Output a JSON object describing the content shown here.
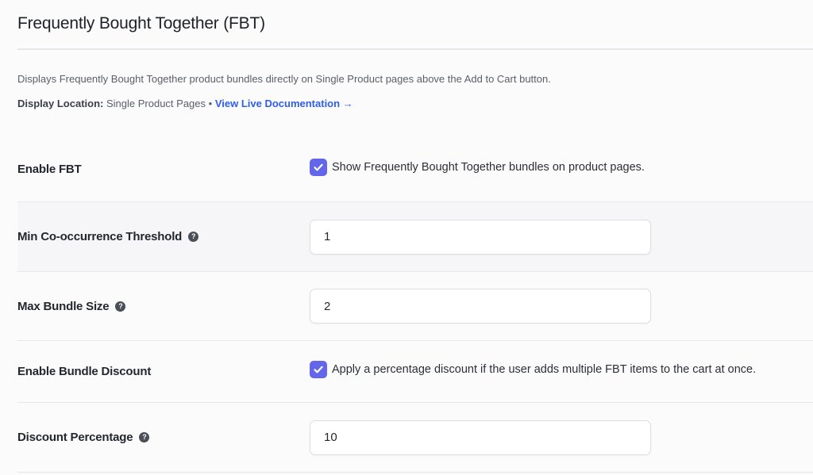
{
  "header": {
    "title": "Frequently Bought Together (FBT)"
  },
  "description": "Displays Frequently Bought Together product bundles directly on Single Product pages above the Add to Cart button.",
  "display_location": {
    "label": "Display Location:",
    "value": "Single Product Pages",
    "separator": "•",
    "doc_link": "View Live Documentation →"
  },
  "settings": {
    "enable_fbt": {
      "label": "Enable FBT",
      "checked": true,
      "checkbox_text": "Show Frequently Bought Together bundles on product pages."
    },
    "min_cooccurrence": {
      "label": "Min Co-occurrence Threshold",
      "value": "1",
      "help_icon": "question-circle-icon"
    },
    "max_bundle_size": {
      "label": "Max Bundle Size",
      "value": "2",
      "help_icon": "question-circle-icon"
    },
    "enable_discount": {
      "label": "Enable Bundle Discount",
      "checked": true,
      "checkbox_text": "Apply a percentage discount if the user adds multiple FBT items to the cart at once."
    },
    "discount_percentage": {
      "label": "Discount Percentage",
      "value": "10",
      "help_icon": "question-circle-icon"
    }
  },
  "colors": {
    "accent": "#6366e8",
    "link": "#2f5ee8",
    "row_shade": "#f6f6f8",
    "divider": "#e6e7ea"
  }
}
